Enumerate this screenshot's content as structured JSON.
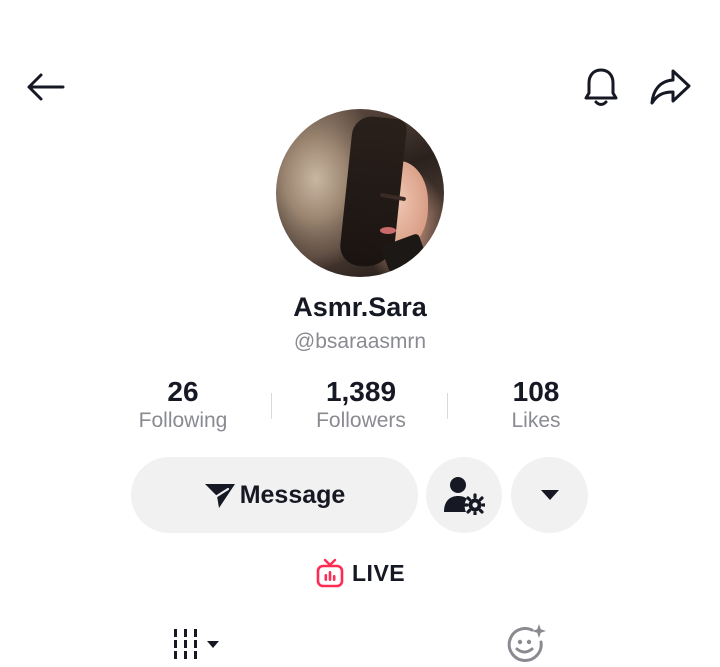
{
  "header": {
    "back_icon": "arrow-left-icon",
    "bell_icon": "bell-icon",
    "share_icon": "share-arrow-icon"
  },
  "profile": {
    "display_name": "Asmr.Sara",
    "username": "@bsaraasmrn"
  },
  "stats": [
    {
      "value": "26",
      "label": "Following"
    },
    {
      "value": "1,389",
      "label": "Followers"
    },
    {
      "value": "108",
      "label": "Likes"
    }
  ],
  "actions": {
    "message_label": "Message",
    "message_icon": "send-icon",
    "friend_settings_icon": "user-gear-icon",
    "more_icon": "caret-down-icon"
  },
  "live": {
    "label": "LIVE",
    "icon": "live-tv-icon",
    "color": "#fe2c55"
  },
  "tabs": {
    "videos_icon": "grid-bars-icon",
    "face_icon": "smile-sparkle-icon"
  }
}
